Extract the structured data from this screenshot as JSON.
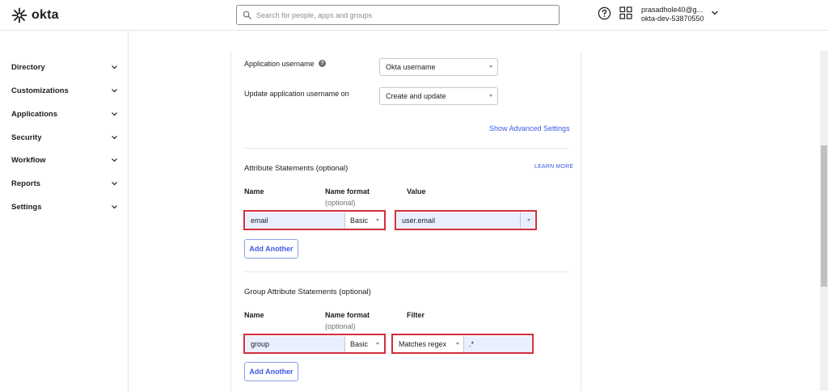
{
  "app": {
    "brand": "okta",
    "brand_color": "#1d1d21",
    "accent": "#3f59e4",
    "highlight": "#d32f3c"
  },
  "header": {
    "search_placeholder": "Search for people, apps and groups",
    "user_email": "prasadhole40@g...",
    "user_org": "okta-dev-53870550"
  },
  "sidebar": {
    "items": [
      {
        "label": "Directory"
      },
      {
        "label": "Customizations"
      },
      {
        "label": "Applications"
      },
      {
        "label": "Security"
      },
      {
        "label": "Workflow"
      },
      {
        "label": "Reports"
      },
      {
        "label": "Settings"
      }
    ]
  },
  "form": {
    "app_username_label": "Application username",
    "app_username_value": "Okta username",
    "update_on_label": "Update application username on",
    "update_on_value": "Create and update",
    "advanced_link": "Show Advanced Settings"
  },
  "attr": {
    "title": "Attribute Statements (optional)",
    "learn_more": "LEARN MORE",
    "col_name": "Name",
    "col_format": "Name format",
    "col_format_sub": "(optional)",
    "col_value": "Value",
    "name_value": "email",
    "format_value": "Basic",
    "value_value": "user.email",
    "add_button": "Add Another"
  },
  "group": {
    "title": "Group Attribute Statements (optional)",
    "col_name": "Name",
    "col_format": "Name format",
    "col_format_sub": "(optional)",
    "col_filter": "Filter",
    "name_value": "group",
    "format_value": "Basic",
    "filter_type": "Matches regex",
    "filter_value": ".*",
    "add_button": "Add Another"
  }
}
